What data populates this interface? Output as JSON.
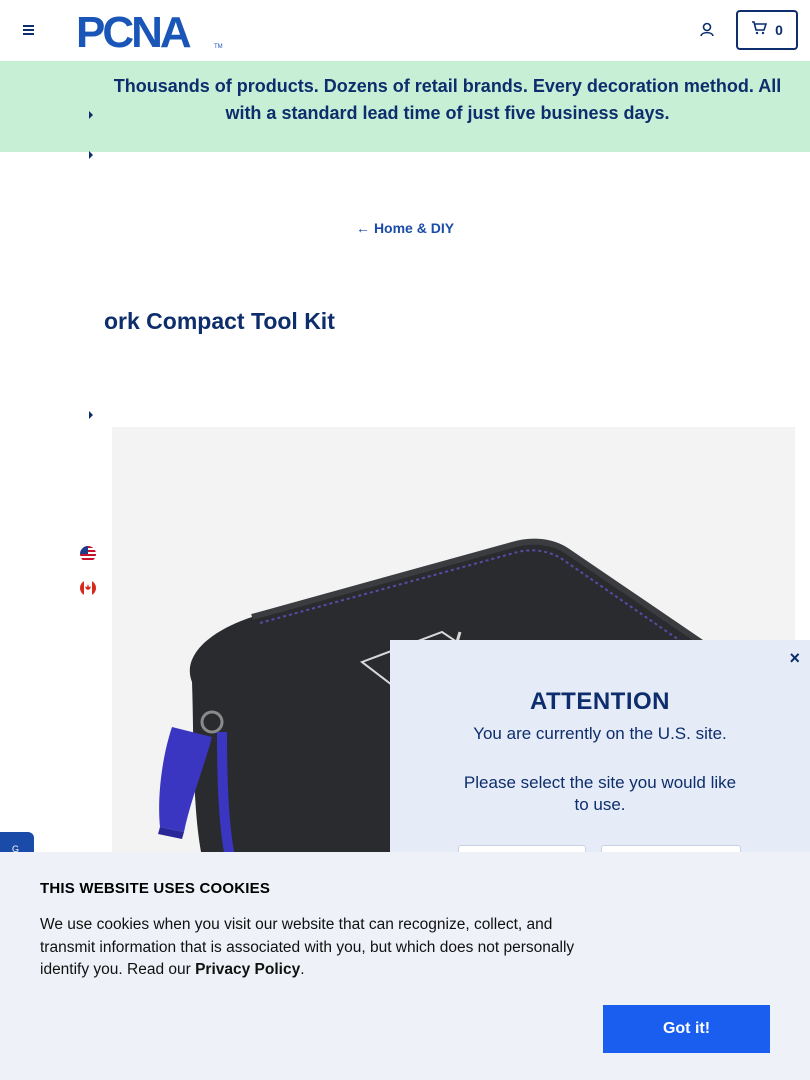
{
  "header": {
    "logo_text": "PCNA",
    "cart_count": "0",
    "brand_color": "#0d2d6c"
  },
  "promo": {
    "text": "Thousands of products. Dozens of retail brands. Every decoration method. All with a standard lead time of just five business days.",
    "background": "#c6efd6"
  },
  "breadcrumb": {
    "back_arrow": "←",
    "back_label": "Home & DIY"
  },
  "product": {
    "title": "ork Compact Tool Kit"
  },
  "attention_modal": {
    "close": "×",
    "title": "ATTENTION",
    "current_site": "You are currently on the U.S. site.",
    "prompt": "Please select the site you would like to use."
  },
  "chat": {
    "label": "G"
  },
  "cookie_banner": {
    "title": "THIS WEBSITE USES COOKIES",
    "text_before": "We use cookies when you visit our website that can recognize, collect, and transmit information that is associated with you, but which does not personally identify you. Read our ",
    "policy_link": "Privacy Policy",
    "text_after": ".",
    "button": "Got it!",
    "button_color": "#1a5ef0"
  }
}
